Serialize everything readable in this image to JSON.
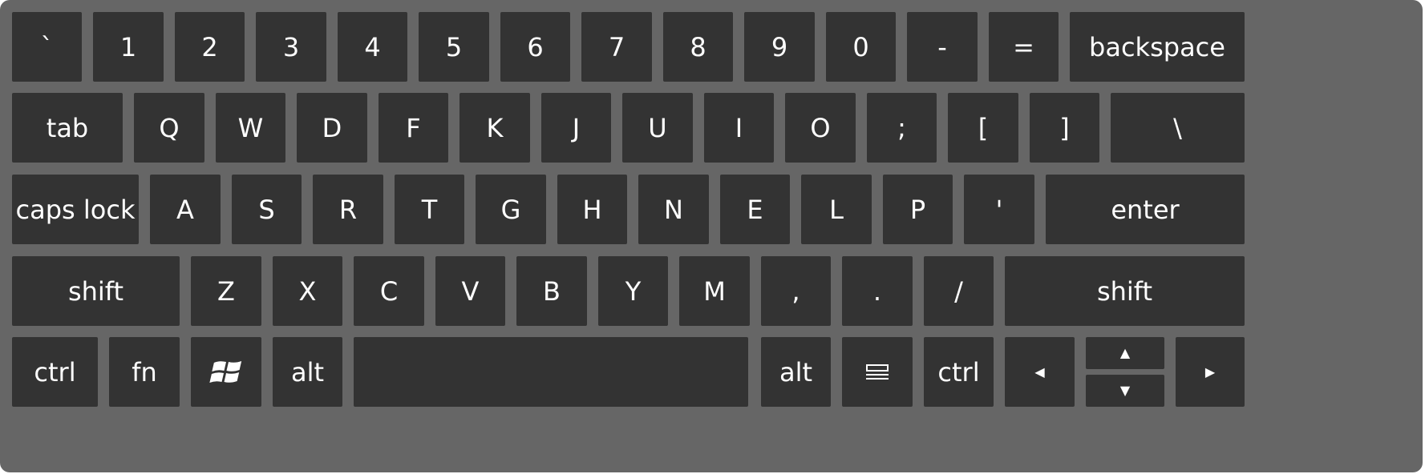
{
  "colors": {
    "board": "#666666",
    "key": "#333333",
    "text": "#ffffff"
  },
  "row1": [
    "`",
    "1",
    "2",
    "3",
    "4",
    "5",
    "6",
    "7",
    "8",
    "9",
    "0",
    "-",
    "=",
    "backspace"
  ],
  "row2": [
    "tab",
    "Q",
    "W",
    "D",
    "F",
    "K",
    "J",
    "U",
    "I",
    "O",
    ";",
    "[",
    "]",
    "\\"
  ],
  "row3": [
    "caps lock",
    "A",
    "S",
    "R",
    "T",
    "G",
    "H",
    "N",
    "E",
    "L",
    "P",
    "'",
    "enter"
  ],
  "row4": [
    "shift",
    "Z",
    "X",
    "C",
    "V",
    "B",
    "Y",
    "M",
    ",",
    ".",
    "/",
    "shift"
  ],
  "row5": {
    "ctrl_left": "ctrl",
    "fn": "fn",
    "win_icon": "windows-logo-icon",
    "alt_left": "alt",
    "space": "",
    "alt_right": "alt",
    "menu_icon": "menu-icon",
    "ctrl_right": "ctrl",
    "arrow_left": "◀",
    "arrow_up": "▲",
    "arrow_down": "▼",
    "arrow_right": "▶"
  }
}
